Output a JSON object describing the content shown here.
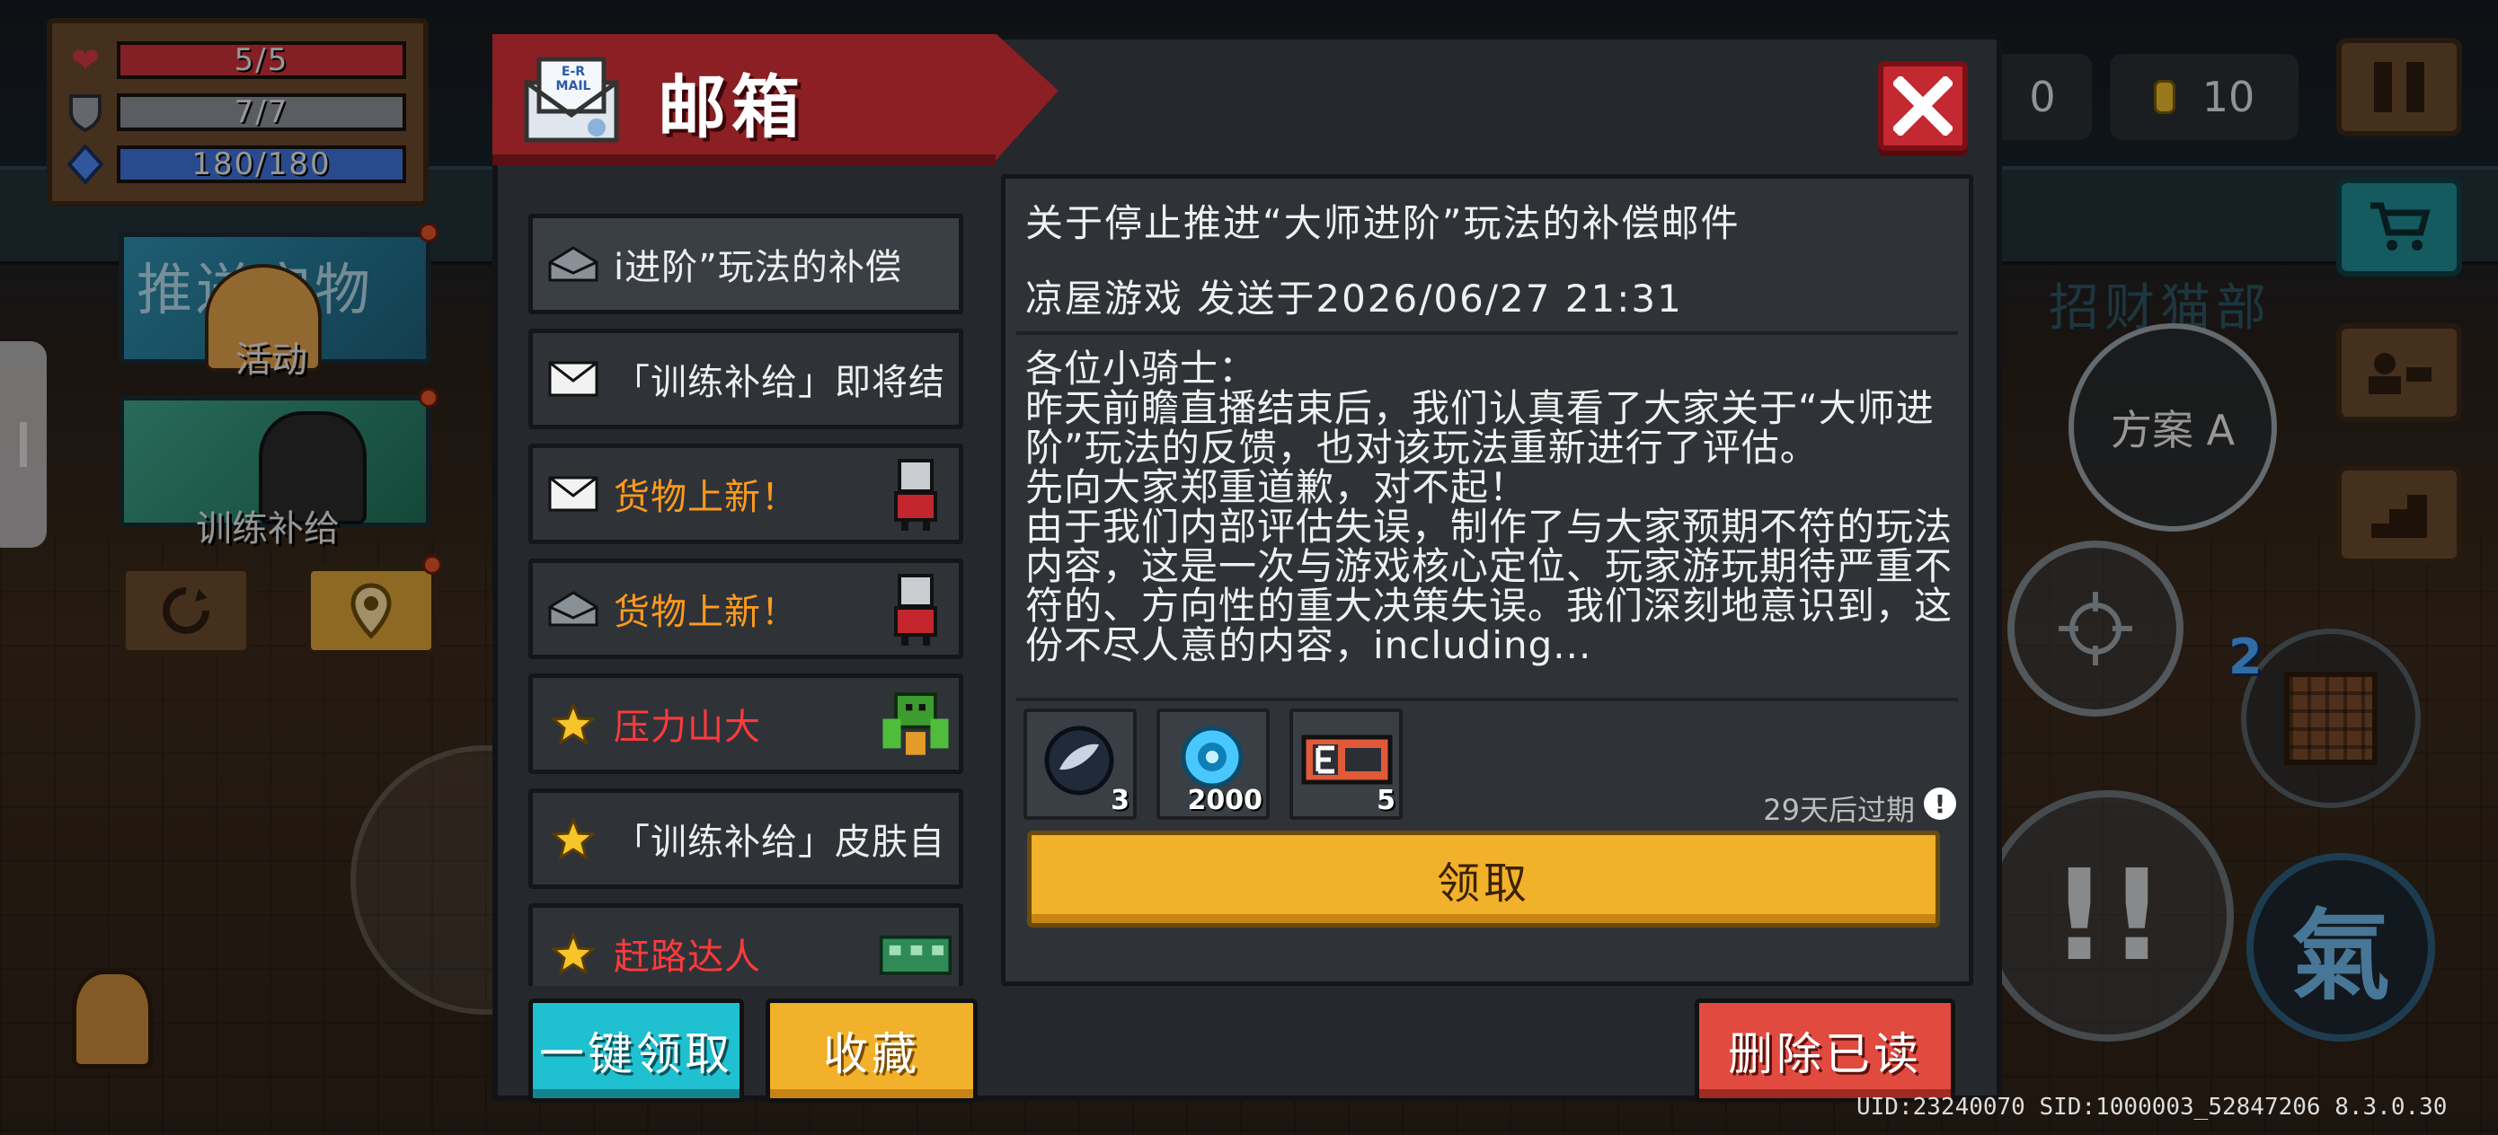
{
  "hud": {
    "health": {
      "text": "5/5",
      "fraction": 1.0,
      "color": "#c8323a"
    },
    "armor": {
      "text": "7/7",
      "fraction": 1.0,
      "color": "#8a8f96"
    },
    "energy": {
      "text": "180/180",
      "fraction": 1.0,
      "color": "#3f72d8"
    },
    "gem_count": "0",
    "coin_count": "10",
    "mode_button": "方案 A",
    "background_sign": "招财猫部",
    "event_labels": [
      "活动",
      "训练补给"
    ],
    "event_banner_text": "推送宝物",
    "skill_badge": "2",
    "skill_char": "氣",
    "uid_line": "UID:23240070 SID:1000003_52847206 8.3.0.30"
  },
  "mailbox": {
    "title": "邮箱",
    "mail_icon_text": "E-R MAIL",
    "close_icon": "close-x-icon",
    "items": [
      {
        "title": "i进阶”玩法的补偿",
        "icon": "opened-envelope-icon",
        "style": "normal",
        "thumb": ""
      },
      {
        "title": "「训练补给」即将结",
        "icon": "envelope-icon",
        "style": "normal",
        "thumb": ""
      },
      {
        "title": "货物上新！",
        "icon": "envelope-icon",
        "style": "orange",
        "thumb": "cat-merchant-thumb"
      },
      {
        "title": "货物上新！",
        "icon": "opened-envelope-icon",
        "style": "orange",
        "thumb": "cat-merchant-thumb"
      },
      {
        "title": "压力山大",
        "icon": "star-icon",
        "style": "red",
        "thumb": "green-monster-thumb"
      },
      {
        "title": "「训练补给」皮肤自",
        "icon": "star-icon",
        "style": "normal",
        "thumb": ""
      },
      {
        "title": "赶路达人",
        "icon": "star-icon",
        "style": "red",
        "thumb": "green-train-thumb"
      }
    ],
    "detail": {
      "title": "关于停止推进“大师进阶”玩法的补偿邮件",
      "sender": "凉屋游戏 发送于2026/06/27 21:31",
      "body": [
        "各位小骑士：",
        "昨天前瞻直播结束后，我们认真看了大家关于“大师进阶”玩法的反馈，也对该玩法重新进行了评估。",
        "先向大家郑重道歉，对不起！",
        "由于我们内部评估失误，制作了与大家预期不符的玩法内容，这是一次与游戏核心定位、玩家游玩期待严重不符的、方向性的重大决策失误。我们深刻地意识到，这份不尽人意的内容，including..."
      ],
      "rewards": [
        {
          "item": "fish-token-icon",
          "count": "3"
        },
        {
          "item": "blue-gem-icon",
          "count": "2000"
        },
        {
          "item": "e-card-icon",
          "count": "5"
        }
      ],
      "expire_text": "29天后过期",
      "claim_label": "领取"
    },
    "buttons": {
      "claim_all": "一键领取",
      "favorite": "收藏",
      "delete_read": "删除已读"
    }
  },
  "colors": {
    "dialog_bg": "#25282d",
    "banner_red": "#8b1f24",
    "claim_yellow": "#f2b12a",
    "claim_all_cyan": "#1fc0cf",
    "delete_red": "#e04a3f"
  }
}
